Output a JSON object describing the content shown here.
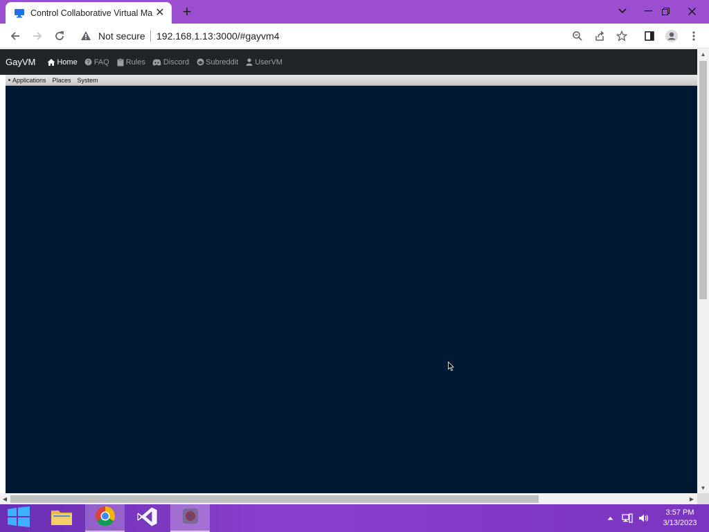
{
  "browser": {
    "tab": {
      "title": "Control Collaborative Virtual Ma",
      "close_glyph": "✕"
    },
    "new_tab_glyph": "+",
    "security_label": "Not secure",
    "url": "192.168.1.13:3000/#gayvm4",
    "window_controls": {
      "chevron": "⌄",
      "minimize": "—",
      "restore": "❐",
      "close": "✕"
    }
  },
  "site": {
    "brand": "GayVM",
    "nav": [
      {
        "label": "Home",
        "icon": "home-icon",
        "active": true
      },
      {
        "label": "FAQ",
        "icon": "question-icon"
      },
      {
        "label": "Rules",
        "icon": "clipboard-icon"
      },
      {
        "label": "Discord",
        "icon": "discord-icon"
      },
      {
        "label": "Subreddit",
        "icon": "reddit-icon"
      },
      {
        "label": "UserVM",
        "icon": "user-icon"
      }
    ]
  },
  "vm": {
    "menu": [
      "Applications",
      "Places",
      "System"
    ],
    "desktop_color": "#001a33"
  },
  "taskbar": {
    "clock": {
      "time": "3:57 PM",
      "date": "3/13/2023"
    }
  },
  "colors": {
    "tabstrip": "#9b4fd0",
    "navbar": "#212529",
    "taskbar": "#7a35c0"
  }
}
